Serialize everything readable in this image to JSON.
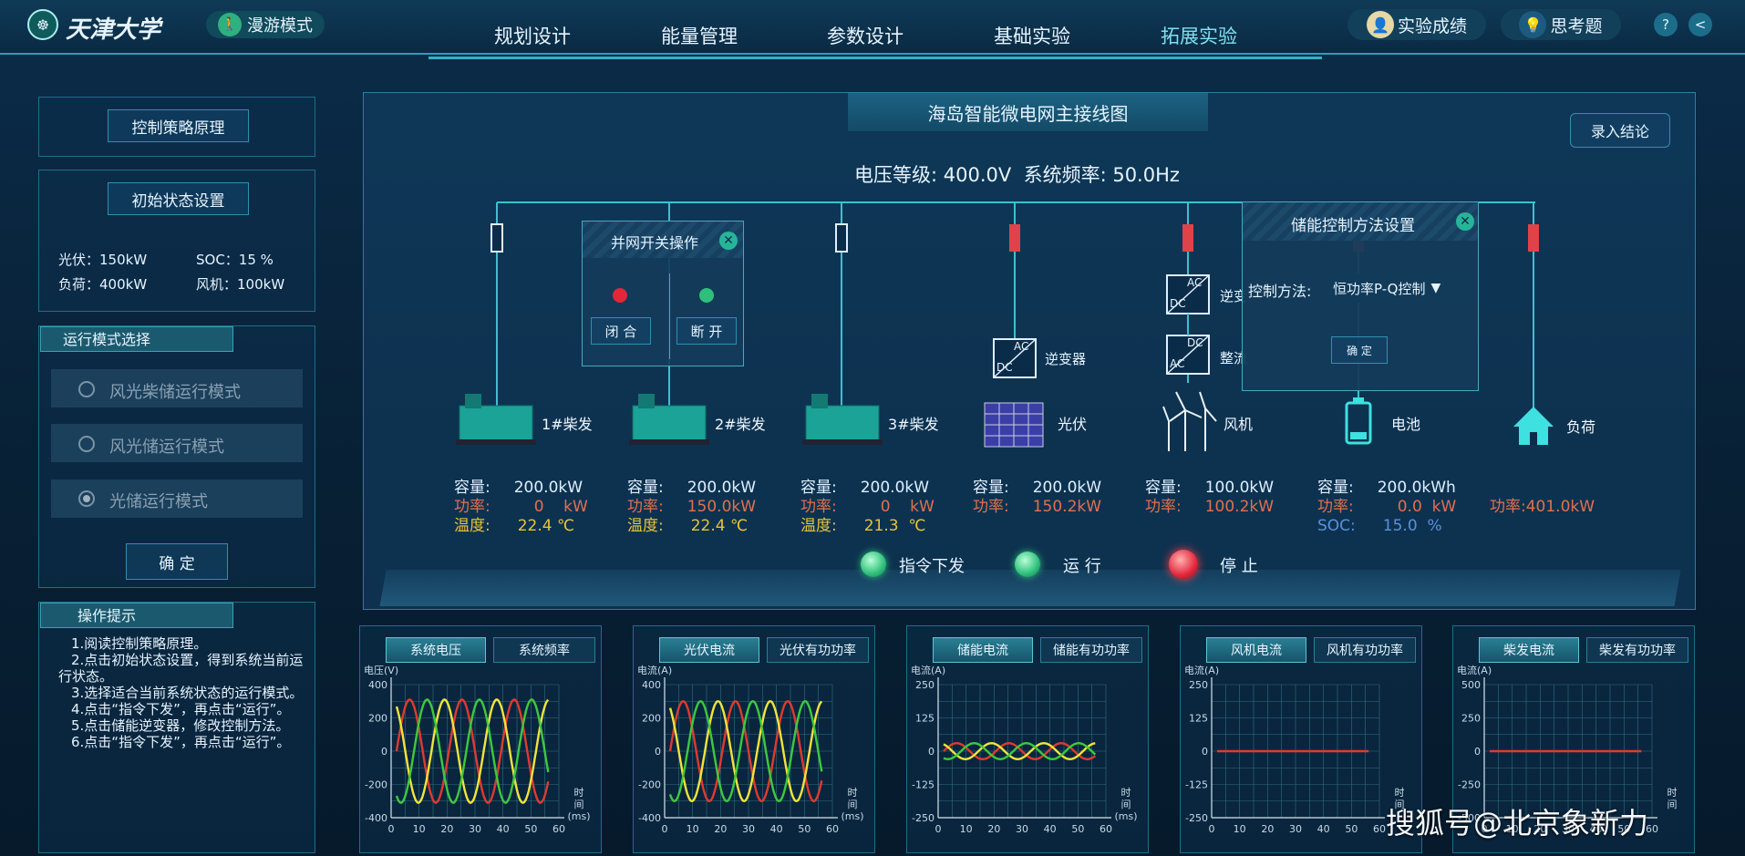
{
  "header": {
    "logo_text": "天津大学",
    "roam": "漫游模式",
    "nav": [
      "规划设计",
      "能量管理",
      "参数设计",
      "基础实验",
      "拓展实验"
    ],
    "active_nav": 4,
    "scores": "实验成绩",
    "thinking": "思考题",
    "help": "?",
    "back": "<"
  },
  "left": {
    "strategy": "控制策略原理",
    "init_title": "初始状态设置",
    "init": [
      [
        "光伏：150kW",
        "SOC：15 %"
      ],
      [
        "负荷：400kW",
        "风机：100kW"
      ]
    ],
    "mode_title": "运行模式选择",
    "modes": [
      "风光柴储运行模式",
      "风光储运行模式",
      "光储运行模式"
    ],
    "selected_mode": 2,
    "confirm": "确 定",
    "tips_title": "操作提示",
    "tips": [
      "1.阅读控制策略原理。",
      "2.点击初始状态设置，得到系统当前运行状态。",
      "3.选择适合当前系统状态的运行模式。",
      "4.点击“指令下发”，再点击“运行”。",
      "5.点击储能逆变器，修改控制方法。",
      "6.点击“指令下发”，再点击“运行”。"
    ]
  },
  "main": {
    "title": "海岛智能微电网主接线图",
    "record": "录入结论",
    "voltage": "电压等级: 400.0V  系统频率: 50.0Hz",
    "switch_popup": {
      "title": "并网开关操作",
      "close": "闭 合",
      "open": "断 开"
    },
    "storage_popup": {
      "title": "储能控制方法设置",
      "method_label": "控制方法:",
      "method": "恒功率P-Q控制",
      "confirm": "确 定"
    },
    "converter": "逆变器",
    "inverter_cut": "逆变",
    "rectifier_cut": "整流",
    "ac": "AC",
    "dc": "DC",
    "units": [
      {
        "name": "1#柴发",
        "rows": [
          [
            "容量:",
            "200.0kW",
            "wht"
          ],
          [
            "功率:",
            "0    kW",
            "red"
          ],
          [
            "温度:",
            "22.4 ℃",
            "yel"
          ]
        ]
      },
      {
        "name": "2#柴发",
        "rows": [
          [
            "容量:",
            "200.0kW",
            "wht"
          ],
          [
            "功率:",
            "150.0kW",
            "red"
          ],
          [
            "温度:",
            "22.4 ℃",
            "yel"
          ]
        ]
      },
      {
        "name": "3#柴发",
        "rows": [
          [
            "容量:",
            "200.0kW",
            "wht"
          ],
          [
            "功率:",
            "0    kW",
            "red"
          ],
          [
            "温度:",
            "21.3  ℃",
            "yel"
          ]
        ]
      },
      {
        "name": "光伏",
        "rows": [
          [
            "容量:",
            "200.0kW",
            "wht"
          ],
          [
            "功率:",
            "150.2kW",
            "red"
          ]
        ]
      },
      {
        "name": "风机",
        "rows": [
          [
            "容量:",
            "100.0kW",
            "wht"
          ],
          [
            "功率:",
            "100.2kW",
            "red"
          ]
        ]
      },
      {
        "name": "电池",
        "rows": [
          [
            "容量:",
            "200.0kWh",
            "wht"
          ],
          [
            "功率:",
            "0.0  kW",
            "red"
          ],
          [
            "SOC:",
            "15.0  %",
            "blu"
          ]
        ]
      },
      {
        "name": "负荷",
        "rows": [
          [
            "功率:",
            "401.0kW",
            "red"
          ]
        ]
      }
    ],
    "controls": [
      "指令下发",
      "运 行",
      "停 止"
    ]
  },
  "charts": [
    {
      "tabs": [
        "系统电压",
        "系统频率"
      ],
      "ylabel": "电压(V)",
      "yticks": [
        "400",
        "200",
        "0",
        "-200",
        "-400"
      ],
      "xticks": [
        "0",
        "10",
        "20",
        "30",
        "40",
        "50",
        "60"
      ],
      "xunit": [
        "时",
        "间",
        "(ms)"
      ]
    },
    {
      "tabs": [
        "光伏电流",
        "光伏有功功率"
      ],
      "ylabel": "电流(A)",
      "yticks": [
        "400",
        "200",
        "0",
        "-200",
        "-400"
      ],
      "xticks": [
        "0",
        "10",
        "20",
        "30",
        "40",
        "50",
        "60"
      ],
      "xunit": [
        "时",
        "间",
        "(ms)"
      ]
    },
    {
      "tabs": [
        "储能电流",
        "储能有功功率"
      ],
      "ylabel": "电流(A)",
      "yticks": [
        "250",
        "125",
        "0",
        "-125",
        "-250"
      ],
      "xticks": [
        "0",
        "10",
        "20",
        "30",
        "40",
        "50",
        "60"
      ],
      "xunit": [
        "时",
        "间",
        "(ms)"
      ]
    },
    {
      "tabs": [
        "风机电流",
        "风机有功功率"
      ],
      "ylabel": "电流(A)",
      "yticks": [
        "250",
        "125",
        "0",
        "-125",
        "-250"
      ],
      "xticks": [
        "0",
        "10",
        "20",
        "30",
        "40",
        "50",
        "60"
      ],
      "xunit": [
        "时",
        "间"
      ]
    },
    {
      "tabs": [
        "柴发电流",
        "柴发有功功率"
      ],
      "ylabel": "电流(A)",
      "yticks": [
        "500",
        "250",
        "0",
        "-250",
        "-500"
      ],
      "xticks": [
        "0",
        "10",
        "20",
        "30",
        "40",
        "50",
        "60"
      ],
      "xunit": [
        "时",
        "间"
      ]
    }
  ],
  "chart_data": [
    {
      "type": "line",
      "x_range": [
        0,
        60
      ],
      "y_range": [
        -400,
        400
      ],
      "series": [
        {
          "color": "#e03a2f",
          "amplitude": 310,
          "period_ms": 20,
          "phase_deg": 0
        },
        {
          "color": "#f2e43a",
          "amplitude": 310,
          "period_ms": 20,
          "phase_deg": 120
        },
        {
          "color": "#3ec93e",
          "amplitude": 310,
          "period_ms": 20,
          "phase_deg": 240
        }
      ]
    },
    {
      "type": "line",
      "x_range": [
        0,
        60
      ],
      "y_range": [
        -400,
        400
      ],
      "series": [
        {
          "color": "#e03a2f",
          "amplitude": 300,
          "period_ms": 20,
          "phase_deg": 0
        },
        {
          "color": "#f2e43a",
          "amplitude": 300,
          "period_ms": 20,
          "phase_deg": 120
        },
        {
          "color": "#3ec93e",
          "amplitude": 300,
          "period_ms": 20,
          "phase_deg": 240
        }
      ]
    },
    {
      "type": "line",
      "x_range": [
        0,
        60
      ],
      "y_range": [
        -250,
        250
      ],
      "series": [
        {
          "color": "#e03a2f",
          "amplitude": 30,
          "period_ms": 20,
          "phase_deg": 0
        },
        {
          "color": "#f2e43a",
          "amplitude": 30,
          "period_ms": 20,
          "phase_deg": 120
        },
        {
          "color": "#3ec93e",
          "amplitude": 30,
          "period_ms": 20,
          "phase_deg": 240
        }
      ]
    },
    {
      "type": "line",
      "x_range": [
        0,
        60
      ],
      "y_range": [
        -250,
        250
      ],
      "series": [
        {
          "color": "#e03a2f",
          "amplitude": 0,
          "period_ms": 20,
          "phase_deg": 0
        }
      ]
    },
    {
      "type": "line",
      "x_range": [
        0,
        60
      ],
      "y_range": [
        -500,
        500
      ],
      "series": [
        {
          "color": "#e03a2f",
          "amplitude": 0,
          "period_ms": 20,
          "phase_deg": 0
        }
      ]
    }
  ],
  "watermark": "搜狐号@北京象新力"
}
